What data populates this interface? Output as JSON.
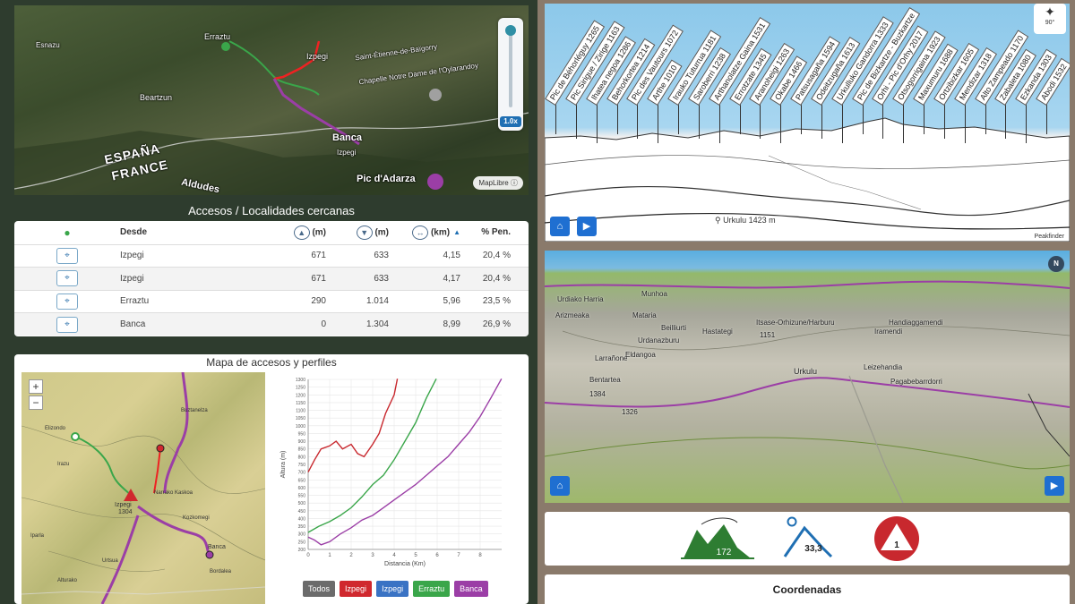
{
  "map3d": {
    "labels": [
      "Erraztu",
      "Izpegi",
      "Beartzun",
      "Banca",
      "ESPAÑA",
      "FRANCE",
      "Aldudes",
      "Pic d'Adarza",
      "Chapelle Notre Dame de l'Oylarandoy",
      "Saint-Étienne-de-Baïgorry",
      "Esnazu",
      "Izpegi"
    ],
    "zoom_value": "1.0x",
    "attribution": "MapLibre"
  },
  "accesos": {
    "title": "Accesos / Localidades cercanas",
    "headers": [
      "",
      "Desde",
      "(m)",
      "(m)",
      "(km)",
      "% Pen."
    ],
    "rows": [
      {
        "desde": "Izpegi",
        "sube": "671",
        "baja": "633",
        "km": "4,15",
        "pen": "20,4 %"
      },
      {
        "desde": "Izpegi",
        "sube": "671",
        "baja": "633",
        "km": "4,17",
        "pen": "20,4 %"
      },
      {
        "desde": "Erraztu",
        "sube": "290",
        "baja": "1.014",
        "km": "5,96",
        "pen": "23,5 %"
      },
      {
        "desde": "Banca",
        "sube": "0",
        "baja": "1.304",
        "km": "8,99",
        "pen": "26,9 %"
      }
    ]
  },
  "perfiles": {
    "title": "Mapa de accesos y perfiles",
    "zoom_in": "+",
    "zoom_out": "−",
    "map_labels": [
      "Elizondo",
      "Buztanelza",
      "Irazu",
      "Iparla",
      "Narrako Kaskoa",
      "Kozkomegi",
      "Banca",
      "Bordalea",
      "Urtsua",
      "Alturako",
      "Izpegi",
      "1304"
    ]
  },
  "chart_data": {
    "type": "line",
    "xlabel": "Distancia (Km)",
    "ylabel": "Altura (m)",
    "xlim": [
      0,
      9
    ],
    "ylim": [
      200,
      1300
    ],
    "xticks": [
      0,
      1,
      2,
      3,
      4,
      5,
      6,
      7,
      8
    ],
    "yticks": [
      200,
      250,
      300,
      350,
      400,
      450,
      500,
      550,
      600,
      650,
      700,
      750,
      800,
      850,
      900,
      950,
      1000,
      1050,
      1100,
      1150,
      1200,
      1250,
      1300
    ],
    "series": [
      {
        "name": "Izpegi",
        "color": "#c8282e",
        "x": [
          0,
          0.3,
          0.6,
          1,
          1.3,
          1.6,
          2,
          2.3,
          2.6,
          3,
          3.3,
          3.6,
          4,
          4.15
        ],
        "y": [
          700,
          780,
          850,
          870,
          900,
          850,
          880,
          820,
          800,
          880,
          950,
          1080,
          1200,
          1304
        ]
      },
      {
        "name": "Erraztu",
        "color": "#3aa64a",
        "x": [
          0,
          0.5,
          1,
          1.5,
          2,
          2.5,
          3,
          3.5,
          4,
          4.5,
          5,
          5.5,
          5.96
        ],
        "y": [
          310,
          350,
          380,
          420,
          470,
          540,
          620,
          680,
          780,
          900,
          1020,
          1180,
          1304
        ]
      },
      {
        "name": "Banca",
        "color": "#9b3ea6",
        "x": [
          0,
          0.3,
          0.6,
          1,
          1.5,
          2,
          2.5,
          3,
          3.5,
          4,
          4.5,
          5,
          5.5,
          6,
          6.5,
          7,
          7.5,
          8,
          8.5,
          8.99
        ],
        "y": [
          280,
          260,
          230,
          250,
          300,
          340,
          390,
          420,
          470,
          520,
          570,
          620,
          680,
          740,
          800,
          880,
          960,
          1060,
          1180,
          1304
        ]
      }
    ],
    "grid": true,
    "legend": "bottom"
  },
  "filters": [
    {
      "label": "Todos",
      "color": "#6b6b6b"
    },
    {
      "label": "Izpegi",
      "color": "#d0282e"
    },
    {
      "label": "Izpegi",
      "color": "#3a73c4"
    },
    {
      "label": "Erraztu",
      "color": "#3aa64a"
    },
    {
      "label": "Banca",
      "color": "#9b3ea6"
    }
  ],
  "panorama": {
    "peaks": [
      "Pic de Béhorléguy 1265",
      "Pic Sirigue / Zirige 1163",
      "Ihatea negoa 1286",
      "Behorkortea 1214",
      "Pic des Vautours 1072",
      "Arthe 1010",
      "Irauko Tuturrua 1181",
      "Saroberri 1238",
      "Arthanolatze Gaina 1531",
      "Errotzate 1345",
      "Aranoheigi 1263",
      "Okabe 1466",
      "Patsusagaña 1594",
      "Odeitzugaña 1613",
      "Urkulluko Gandorra 1333",
      "Pic de Bizkartze - Buzkartze",
      "Orhi - Pic d'Orhy 2017",
      "Otsogorrigaina 1923",
      "Maxumuru 1688",
      "Ortzibizkar 1605",
      "Mendizar 1318",
      "Alto Zampeado 1170",
      "Zabaleta 1080",
      "Ezkanda 1303",
      "Abodi 1532"
    ],
    "location": "Urkulu 1423 m",
    "credit": "Peakfinder",
    "compass": "90°"
  },
  "view3d": {
    "labels": [
      "Urdiako Harria",
      "Munhoa",
      "Arizmeaka",
      "Mataria",
      "Beilliurti",
      "Hastategi",
      "Itsase-Orhizune/Harburu",
      "Handiaggamendi",
      "Iramendi",
      "Urdanazburu",
      "Larrañone",
      "Eldangoa",
      "Urkulu",
      "Leizehandia",
      "Pagabebarrdorri",
      "Bentartea",
      "1384",
      "1326",
      "1151"
    ],
    "north": "N"
  },
  "stats": {
    "distance": "172",
    "slope": "33,3",
    "difficulty": "1"
  },
  "coords": {
    "title": "Coordenadas"
  }
}
